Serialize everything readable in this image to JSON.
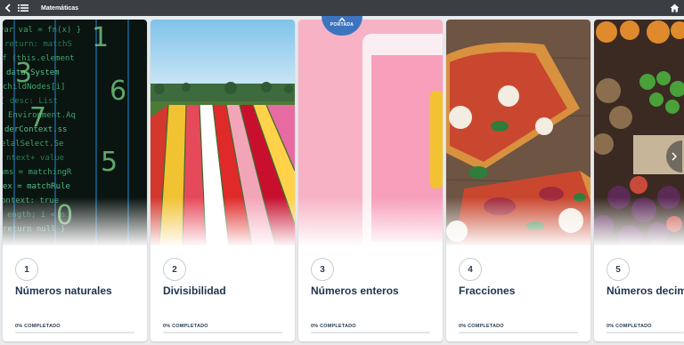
{
  "header": {
    "title": "Matemáticas",
    "icons": [
      "chevron-left-icon",
      "list-icon",
      "home-icon"
    ]
  },
  "portada": {
    "label": "PORTADA"
  },
  "units": [
    {
      "number": "1",
      "title": "Números naturales",
      "progress_label": "0% COMPLETADO",
      "progress": 0
    },
    {
      "number": "2",
      "title": "Divisibilidad",
      "progress_label": "0% COMPLETADO",
      "progress": 0
    },
    {
      "number": "3",
      "title": "Números enteros",
      "progress_label": "0% COMPLETADO",
      "progress": 0
    },
    {
      "number": "4",
      "title": "Fracciones",
      "progress_label": "0% COMPLETADO",
      "progress": 0
    },
    {
      "number": "5",
      "title": "Números decima",
      "progress_label": "0% COMPLETADO",
      "progress": 0
    }
  ],
  "colors": {
    "topbar": "#3b3f44",
    "accent": "#3d74c0",
    "title_text": "#1e3350"
  }
}
